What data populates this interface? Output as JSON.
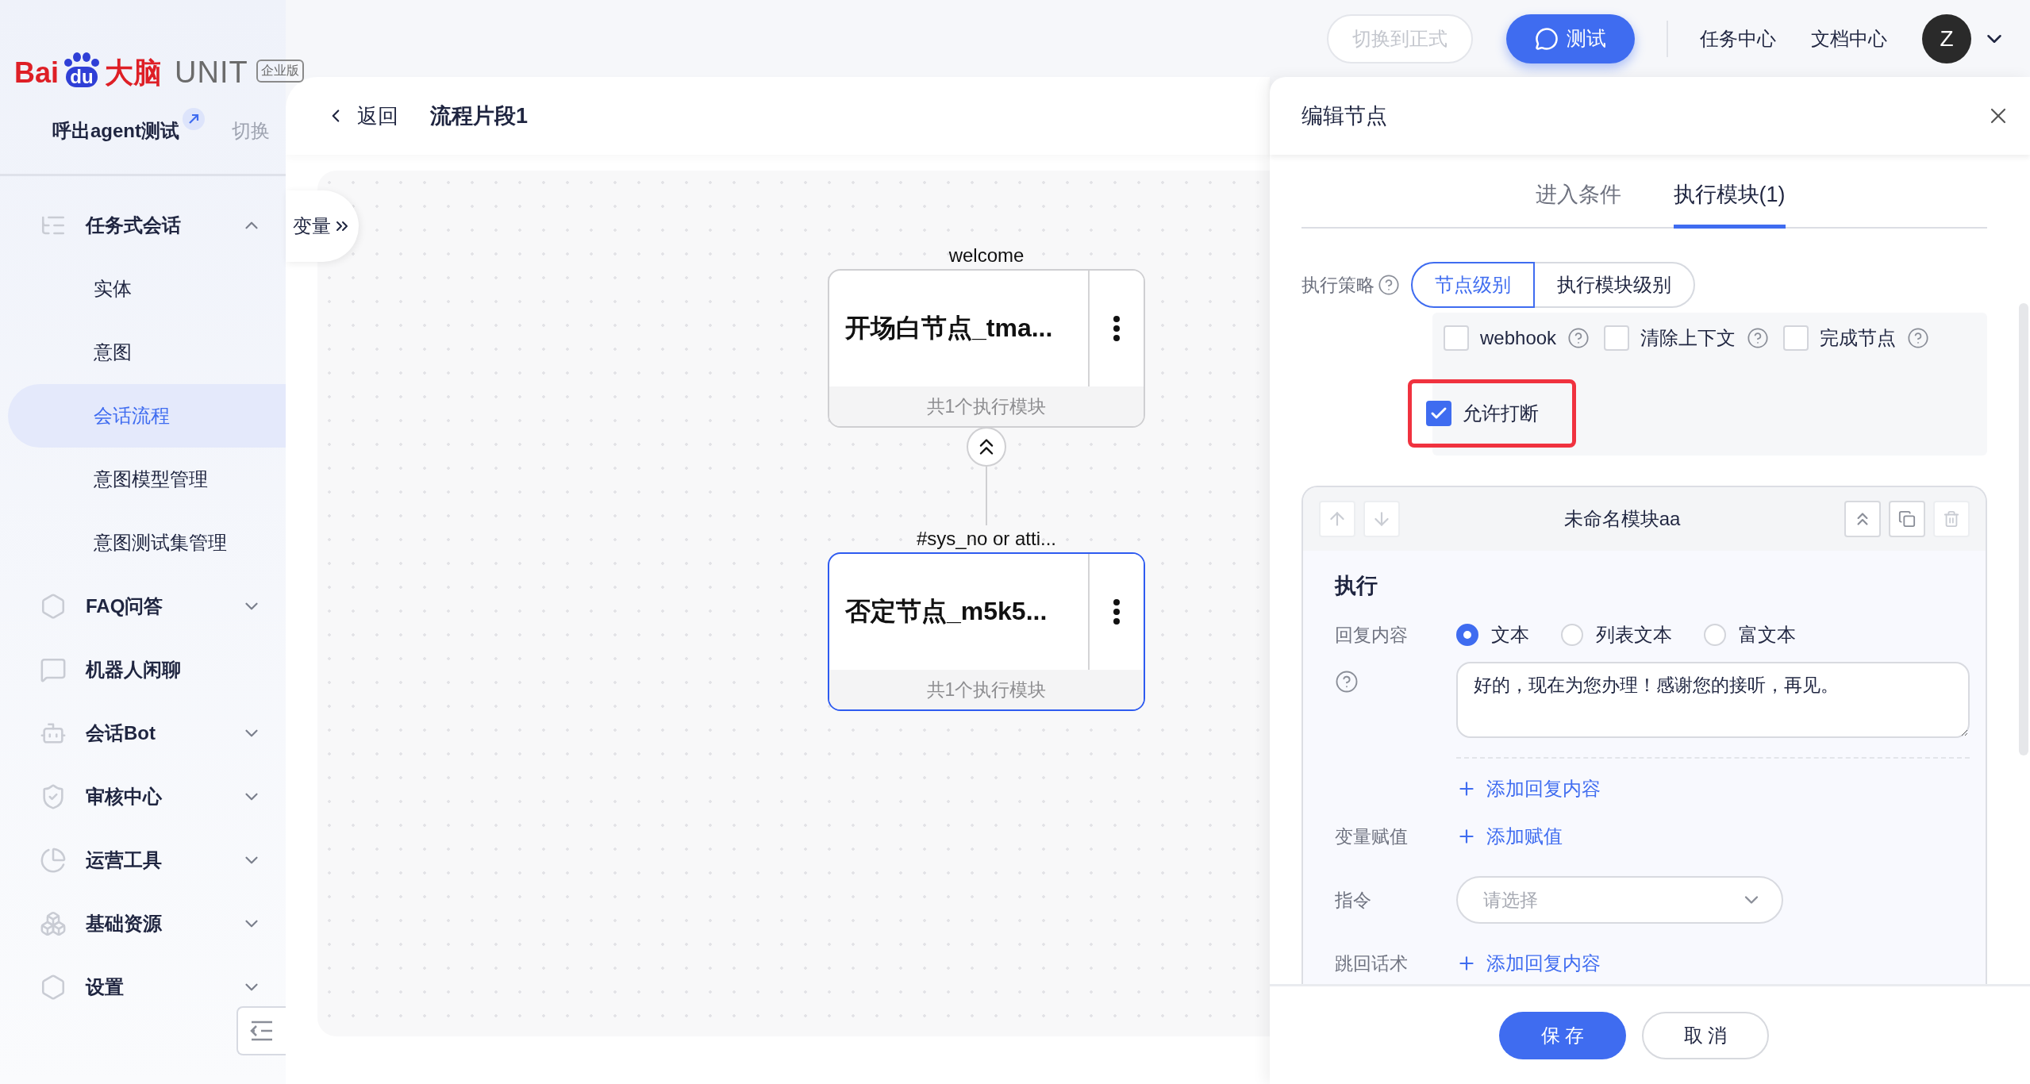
{
  "logo": {
    "brand": "Bai",
    "paw_text": "du",
    "brand_cn": "大脑",
    "product": "UNIT",
    "edition": "企业版"
  },
  "project": {
    "name": "呼出agent测试",
    "switch": "切换"
  },
  "sidebar": {
    "items": [
      {
        "label": "任务式会话",
        "kind": "group",
        "expanded": true,
        "selected": false,
        "children": [
          {
            "label": "实体",
            "selected": false
          },
          {
            "label": "意图",
            "selected": false
          },
          {
            "label": "会话流程",
            "selected": true
          },
          {
            "label": "意图模型管理",
            "selected": false
          },
          {
            "label": "意图测试集管理",
            "selected": false
          }
        ]
      },
      {
        "label": "FAQ问答",
        "kind": "group",
        "expanded": false,
        "selected": false
      },
      {
        "label": "机器人闲聊",
        "kind": "link",
        "selected": false
      },
      {
        "label": "会话Bot",
        "kind": "group",
        "expanded": false,
        "selected": false
      },
      {
        "label": "审核中心",
        "kind": "group",
        "expanded": false,
        "selected": false
      },
      {
        "label": "运营工具",
        "kind": "group",
        "expanded": false,
        "selected": false
      },
      {
        "label": "基础资源",
        "kind": "group",
        "expanded": false,
        "selected": false
      },
      {
        "label": "设置",
        "kind": "group",
        "expanded": false,
        "selected": false
      }
    ]
  },
  "top_bar": {
    "switch_button": {
      "label": "切换到正式",
      "disabled": true
    },
    "test_button": "测试",
    "links": [
      "任务中心",
      "文档中心"
    ],
    "avatar": "Z"
  },
  "breadcrumb": {
    "back": "返回",
    "title": "流程片段1"
  },
  "canvas": {
    "variables_tab": "变量",
    "nodes": [
      {
        "label": "welcome",
        "title": "开场白节点_tma...",
        "footer": "共1个执行模块",
        "selected": false
      },
      {
        "label": "#sys_no or atti...",
        "title": "否定节点_m5k5...",
        "footer": "共1个执行模块",
        "selected": true
      }
    ]
  },
  "panel": {
    "title": "编辑节点",
    "tabs": [
      {
        "label": "进入条件",
        "selected": false
      },
      {
        "label": "执行模块(1)",
        "selected": true
      }
    ],
    "strategy": {
      "label": "执行策略",
      "options": [
        {
          "label": "节点级别",
          "selected": true
        },
        {
          "label": "执行模块级别",
          "selected": false
        }
      ],
      "checkboxes": [
        {
          "label": "webhook",
          "checked": false,
          "help": true,
          "highlighted": false
        },
        {
          "label": "清除上下文",
          "checked": false,
          "help": true,
          "highlighted": false
        },
        {
          "label": "完成节点",
          "checked": false,
          "help": true,
          "highlighted": false
        },
        {
          "label": "允许打断",
          "checked": true,
          "help": false,
          "highlighted": true
        }
      ]
    },
    "module": {
      "title": "未命名模块aa",
      "section": "执行",
      "reply": {
        "label": "回复内容",
        "types": [
          {
            "label": "文本",
            "selected": true
          },
          {
            "label": "列表文本",
            "selected": false
          },
          {
            "label": "富文本",
            "selected": false
          }
        ],
        "value": "好的，现在为您办理！感谢您的接听，再见。",
        "add": "添加回复内容"
      },
      "assign": {
        "label": "变量赋值",
        "add": "添加赋值"
      },
      "command": {
        "label": "指令",
        "placeholder": "请选择"
      },
      "jump": {
        "label": "跳回话术",
        "add": "添加回复内容"
      }
    },
    "footer": {
      "save": "保 存",
      "cancel": "取 消"
    }
  }
}
